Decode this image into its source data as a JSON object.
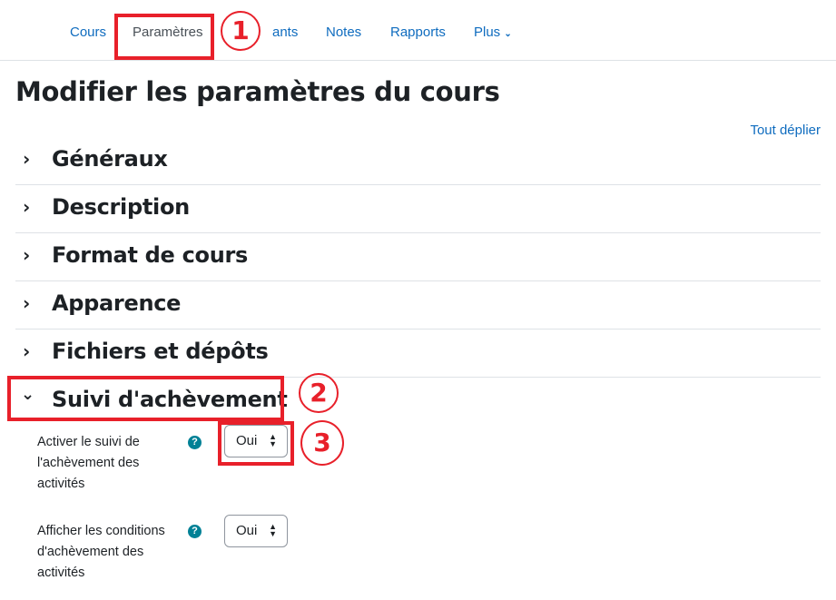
{
  "nav": {
    "tabs": [
      {
        "label": "Cours"
      },
      {
        "label": "Paramètres",
        "active": true
      },
      {
        "label": "ants"
      },
      {
        "label": "Notes"
      },
      {
        "label": "Rapports"
      },
      {
        "label": "Plus"
      }
    ],
    "more_icon": "chevron-down-icon"
  },
  "page_title": "Modifier les paramètres du cours",
  "expand_all": "Tout déplier",
  "sections": [
    {
      "title": "Généraux",
      "expanded": false
    },
    {
      "title": "Description",
      "expanded": false
    },
    {
      "title": "Format de cours",
      "expanded": false
    },
    {
      "title": "Apparence",
      "expanded": false
    },
    {
      "title": "Fichiers et dépôts",
      "expanded": false
    },
    {
      "title": "Suivi d'achèvement",
      "expanded": true
    }
  ],
  "completion": {
    "fields": [
      {
        "label": "Activer le suivi de l'achèvement des activités",
        "value": "Oui",
        "help_icon": "question-circle-icon"
      },
      {
        "label": "Afficher les conditions d'achèvement des activités",
        "value": "Oui",
        "help_icon": "question-circle-icon"
      }
    ]
  },
  "annotations": {
    "color": "#e8202a",
    "steps": [
      "1",
      "2",
      "3"
    ]
  }
}
